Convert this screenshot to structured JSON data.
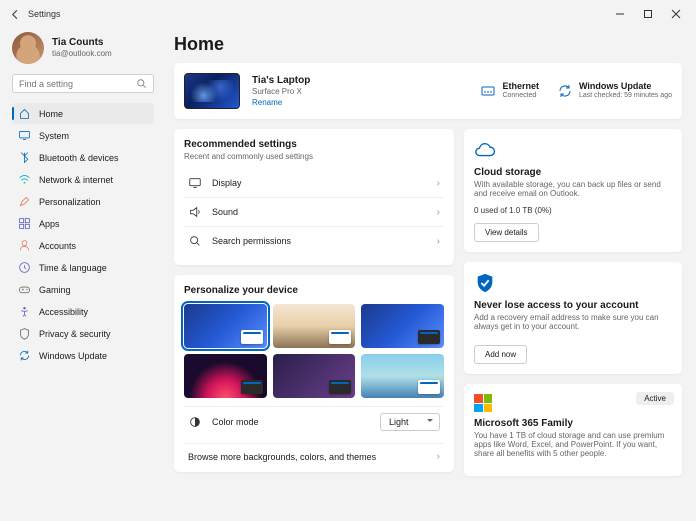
{
  "window": {
    "title": "Settings"
  },
  "profile": {
    "name": "Tia Counts",
    "email": "tia@outlook.com"
  },
  "search": {
    "placeholder": "Find a setting"
  },
  "nav": {
    "items": [
      {
        "label": "Home",
        "icon": "home",
        "color": "#0067c0",
        "active": true
      },
      {
        "label": "System",
        "icon": "system",
        "color": "#0067c0"
      },
      {
        "label": "Bluetooth & devices",
        "icon": "bluetooth",
        "color": "#0067c0"
      },
      {
        "label": "Network & internet",
        "icon": "wifi",
        "color": "#00b7c3"
      },
      {
        "label": "Personalization",
        "icon": "brush",
        "color": "#e3735e"
      },
      {
        "label": "Apps",
        "icon": "apps",
        "color": "#5b5fc7"
      },
      {
        "label": "Accounts",
        "icon": "person",
        "color": "#e3735e"
      },
      {
        "label": "Time & language",
        "icon": "clock",
        "color": "#5b5fc7"
      },
      {
        "label": "Gaming",
        "icon": "game",
        "color": "#666"
      },
      {
        "label": "Accessibility",
        "icon": "access",
        "color": "#5b5fc7"
      },
      {
        "label": "Privacy & security",
        "icon": "shield",
        "color": "#666"
      },
      {
        "label": "Windows Update",
        "icon": "update",
        "color": "#0067c0"
      }
    ]
  },
  "page": {
    "title": "Home"
  },
  "device": {
    "name": "Tia's Laptop",
    "model": "Surface Pro X",
    "rename": "Rename",
    "status": [
      {
        "title": "Ethernet",
        "sub": "Connected",
        "icon": "ethernet"
      },
      {
        "title": "Windows Update",
        "sub": "Last checked: 59 minutes ago",
        "icon": "update"
      }
    ]
  },
  "recommended": {
    "title": "Recommended settings",
    "sub": "Recent and commonly used settings",
    "items": [
      {
        "label": "Display",
        "icon": "display"
      },
      {
        "label": "Sound",
        "icon": "sound"
      },
      {
        "label": "Search permissions",
        "icon": "search"
      }
    ]
  },
  "personalize": {
    "title": "Personalize your device",
    "color_mode_label": "Color mode",
    "color_mode_value": "Light",
    "browse": "Browse more backgrounds, colors, and themes"
  },
  "cloud": {
    "title": "Cloud storage",
    "desc": "With available storage, you can back up files or send and receive email on Outlook.",
    "used": "0 used of 1.0 TB (0%)",
    "button": "View details"
  },
  "recovery": {
    "title": "Never lose access to your account",
    "desc": "Add a recovery email address to make sure you can always get in to your account.",
    "button": "Add now"
  },
  "m365": {
    "badge": "Active",
    "title": "Microsoft 365 Family",
    "desc": "You have 1 TB of cloud storage and can use premium apps like Word, Excel, and PowerPoint. If you want, share all benefits with 5 other people."
  }
}
